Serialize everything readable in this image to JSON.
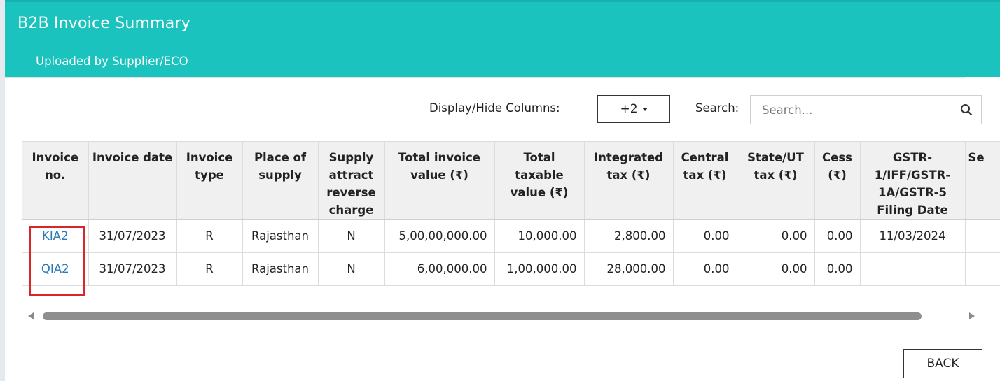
{
  "header": {
    "title": "B2B Invoice Summary",
    "subtitle": "Uploaded by Supplier/ECO"
  },
  "toolbar": {
    "display_hide_label": "Display/Hide Columns:",
    "columns_button_label": "+2",
    "search_label": "Search:",
    "search_placeholder": "Search...",
    "search_value": ""
  },
  "table": {
    "columns": [
      "Invoice no.",
      "Invoice date",
      "Invoice type",
      "Place of supply",
      "Supply attract reverse charge",
      "Total invoice value (₹)",
      "Total taxable value (₹)",
      "Integrated tax (₹)",
      "Central tax (₹)",
      "State/UT tax (₹)",
      "Cess (₹)",
      "GSTR-1/IFF/GSTR-1A/GSTR-5 Filing Date",
      "Se"
    ],
    "rows": [
      [
        "KIA2",
        "31/07/2023",
        "R",
        "Rajasthan",
        "N",
        "5,00,00,000.00",
        "10,000.00",
        "2,800.00",
        "0.00",
        "0.00",
        "0.00",
        "11/03/2024",
        ""
      ],
      [
        "QIA2",
        "31/07/2023",
        "R",
        "Rajasthan",
        "N",
        "6,00,000.00",
        "1,00,000.00",
        "28,000.00",
        "0.00",
        "0.00",
        "0.00",
        "",
        ""
      ]
    ]
  },
  "footer": {
    "back_label": "BACK"
  },
  "colors": {
    "header_bg": "#1ac3bd",
    "link": "#2a7ab8",
    "highlight": "#d9262b"
  }
}
